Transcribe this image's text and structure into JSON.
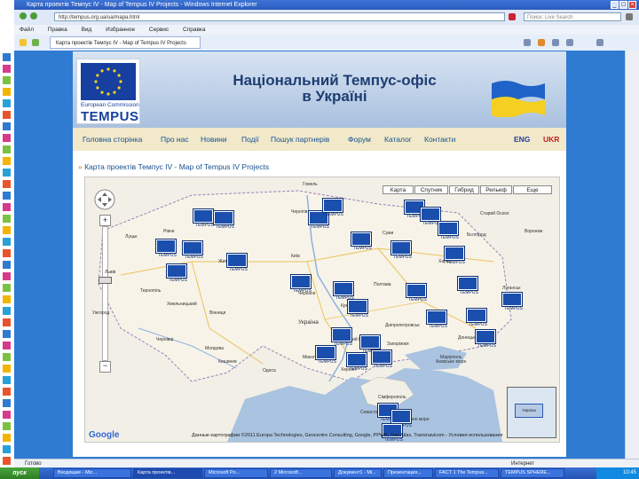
{
  "window": {
    "title": "Карта проектів Темпус IV - Map of Tempus IV Projects - Windows Internet Explorer",
    "url": "http://tempus.org.ua/ua/mapa.html",
    "search_placeholder": "Поиск: Live Search",
    "tab_title": "Карта проектів Темпус IV - Map of Tempus IV Projects",
    "controls": {
      "minimize": "_",
      "maximize": "□",
      "close": "×"
    }
  },
  "menubar": [
    "Файл",
    "Правка",
    "Вид",
    "Избранное",
    "Сервис",
    "Справка"
  ],
  "header": {
    "eu_commission": "European Commission",
    "eu_tempus": "TEMPUS",
    "title_line1": "Національний Темпус-офіс",
    "title_line2": "в Україні"
  },
  "nav": {
    "items": [
      "Головна сторінка",
      "Про нас",
      "Новини",
      "Події",
      "Пошук партнерів",
      "Форум",
      "Каталог",
      "Контакти"
    ],
    "lang_en": "ENG",
    "lang_uk": "UKR"
  },
  "content": {
    "map_heading": "Карта проектів Темпус IV - Map of Tempus IV Projects"
  },
  "map": {
    "types": [
      "Карта",
      "Спутник",
      "Гибрид",
      "Рельеф",
      "Еще"
    ],
    "zoom_in": "+",
    "zoom_out": "−",
    "labels": [
      "Гомель",
      "Чернігів",
      "Суми",
      "Харків",
      "Київ",
      "Житомир",
      "Рівне",
      "Луцьк",
      "Львів",
      "Тернопіль",
      "Хмельницький",
      "Вінниця",
      "Черкаси",
      "Полтава",
      "Кременчук",
      "Україна",
      "Дніпропетровськ",
      "Донецьк",
      "Луганськ",
      "Запоріжжя",
      "Кривий Ріг",
      "Миколаїв",
      "Одеса",
      "Херсон",
      "Маріуполь",
      "Ужгород",
      "Чернівці",
      "Кишинев",
      "Молдова",
      "Сімферополь",
      "Севастополь",
      "Азовське море",
      "Чорне море",
      "Старий Оскол",
      "Воронеж",
      "Бєлгород"
    ],
    "marker_label": "TEMPUS",
    "copyright": "Данные картографии ©2011 Europa Technologies, Geocentre Consulting, Google, PPWK, Tele Atlas, Transnavicom - Условия использования",
    "google": "Google",
    "mini_map_label": "Україна"
  },
  "status": {
    "text": "Готово",
    "zone": "Интернет"
  },
  "taskbar": {
    "start": "пуск",
    "tasks": [
      "Входящие - Mic...",
      "Карта проектів...",
      "Microsoft Po...",
      "2 Microsoft...",
      "Документ1 - Mi...",
      "Презентация...",
      "FACT 1 The Tempus...",
      "TEMPUS SPHERE..."
    ],
    "clock": "10:45"
  }
}
